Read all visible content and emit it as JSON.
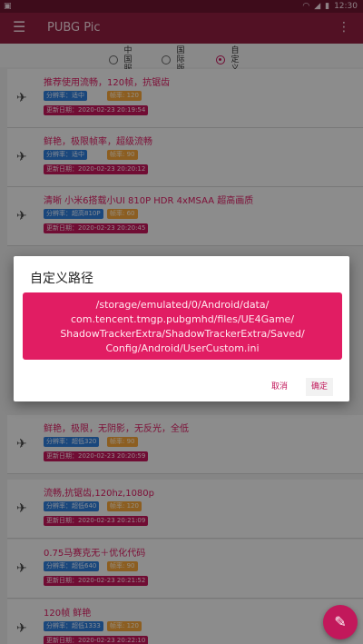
{
  "status_bar": {
    "left_icon": "notification-icon",
    "time": "12:30",
    "right_icons": [
      "wifi-icon",
      "signal-icon",
      "battery-icon"
    ]
  },
  "toolbar": {
    "title": "PUBG Pic",
    "menu_icon": "menu-icon",
    "more_icon": "more-icon"
  },
  "region_options": [
    {
      "label": "中国服",
      "selected": false
    },
    {
      "label": "国际版",
      "selected": false
    },
    {
      "label": "自定义",
      "selected": true
    }
  ],
  "configs": [
    {
      "title": "推荐使用流畅，120帧，抗锯齿",
      "tags": [
        "分辨率：适中",
        "帧率: 120"
      ],
      "date": "更新日期：2020-02-23 20:19:54"
    },
    {
      "title": "鲜艳，极限帧率，超级流畅",
      "tags": [
        "分辨率：适中",
        "帧率: 90"
      ],
      "date": "更新日期：2020-02-23 20:20:12"
    },
    {
      "title": "清晰 小米6搭载小UI 810P HDR 4xMSAA 超高画质",
      "tags": [
        "分辨率：超高810P",
        "帧率: 60"
      ],
      "date": "更新日期：2020-02-23 20:20:45"
    },
    {
      "title": "鲜艳，极限，无阴影，无反光，全低",
      "tags": [
        "分辨率：超低320",
        "帧率: 90"
      ],
      "date": "更新日期：2020-02-23 20:20:59"
    },
    {
      "title": "流畅,抗锯齿,120hz,1080p",
      "tags": [
        "分辨率：超低640",
        "帧率: 120"
      ],
      "date": "更新日期：2020-02-23 20:21:09"
    },
    {
      "title": "0.75马赛克无＋优化代码",
      "tags": [
        "分辨率：超低640",
        "帧率: 90"
      ],
      "date": "更新日期：2020-02-23 20:21:52"
    },
    {
      "title": "120帧 鲜艳",
      "tags": [
        "分辨率：超低1333",
        "帧率: 120"
      ],
      "date": "更新日期：2020-02-23 20:22:10"
    }
  ],
  "dialog": {
    "title": "自定义路径",
    "path": "/storage/emulated/0/Android/data/\ncom.tencent.tmgp.pubgmhd/files/UE4Game/\nShadowTrackerExtra/ShadowTrackerExtra/Saved/\nConfig/Android/UserCustom.ini",
    "cancel_label": "取消",
    "ok_label": "确定"
  },
  "colors": {
    "status_bar": "#6b1530",
    "toolbar": "#8e1e3f",
    "accent": "#c2185b",
    "path_box": "#e11d63",
    "tag_blue": "#2e7bd6",
    "tag_orange": "#f1a33a"
  },
  "fab_icon": "edit-icon"
}
